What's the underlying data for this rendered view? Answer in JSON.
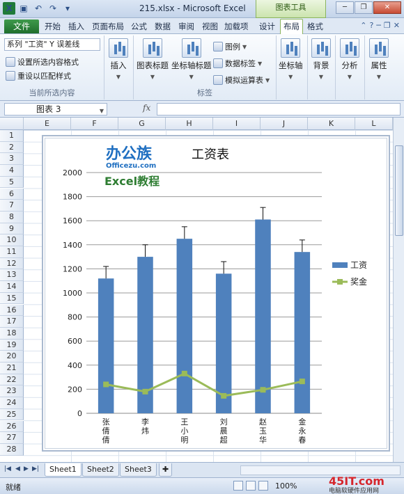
{
  "window": {
    "title": "215.xlsx - Microsoft Excel",
    "context_tools": "图表工具"
  },
  "tabs": {
    "file": "文件",
    "items": [
      "开始",
      "插入",
      "页面布局",
      "公式",
      "数据",
      "审阅",
      "视图",
      "加载项",
      "设计",
      "布局",
      "格式"
    ],
    "active": "布局"
  },
  "ribbon": {
    "selection_combo": "系列 \"工资\" Y 误差线",
    "format_selection": "设置所选内容格式",
    "reset_style": "重设以匹配样式",
    "group1_label": "当前所选内容",
    "insert": "插入",
    "chart_title": "图表标题",
    "axis_title": "坐标轴标题",
    "legend": "图例",
    "data_labels": "数据标签",
    "data_table": "模拟运算表",
    "group2_label": "标签",
    "axes": "坐标轴",
    "background": "背景",
    "analysis": "分析",
    "properties": "属性"
  },
  "formula_bar": {
    "name_box": "图表 3",
    "fx": "fx",
    "value": ""
  },
  "grid": {
    "columns": [
      "E",
      "F",
      "G",
      "H",
      "I",
      "J",
      "K",
      "L"
    ],
    "rows": [
      "1",
      "2",
      "3",
      "4",
      "5",
      "6",
      "7",
      "8",
      "9",
      "10",
      "11",
      "12",
      "13",
      "14",
      "15",
      "16",
      "17",
      "18",
      "19",
      "20",
      "21",
      "22",
      "23",
      "24",
      "25",
      "26",
      "27",
      "28"
    ]
  },
  "chart_data": {
    "type": "bar",
    "title": "工资表",
    "categories": [
      "张倩倩",
      "李炜",
      "王小明",
      "刘晨超",
      "赵玉华",
      "金永春"
    ],
    "series": [
      {
        "name": "工资",
        "type": "bar",
        "values": [
          1120,
          1300,
          1450,
          1160,
          1610,
          1340
        ],
        "error_bar": 100,
        "color": "#4f81bd"
      },
      {
        "name": "奖金",
        "type": "line",
        "values": [
          240,
          180,
          330,
          145,
          195,
          265
        ],
        "color": "#9bbb59"
      }
    ],
    "ylim": [
      0,
      2000
    ],
    "yticks": [
      "0",
      "200",
      "400",
      "600",
      "800",
      "1000",
      "1200",
      "1400",
      "1600",
      "1800",
      "2000"
    ],
    "grid": true,
    "legend": "right"
  },
  "chart_logo": {
    "brand": "办公族",
    "site": "Officezu.com",
    "subtitle": "Excel教程"
  },
  "sheets": {
    "tabs": [
      "Sheet1",
      "Sheet2",
      "Sheet3"
    ],
    "active": "Sheet1"
  },
  "status": {
    "ready": "就绪",
    "zoom": "100%"
  },
  "watermark": {
    "brand": "45IT.com",
    "tagline": "电脑软硬件应用网"
  },
  "colors": {
    "bar": "#4f81bd",
    "line": "#9bbb59",
    "file_tab": "#1f6e2d"
  }
}
